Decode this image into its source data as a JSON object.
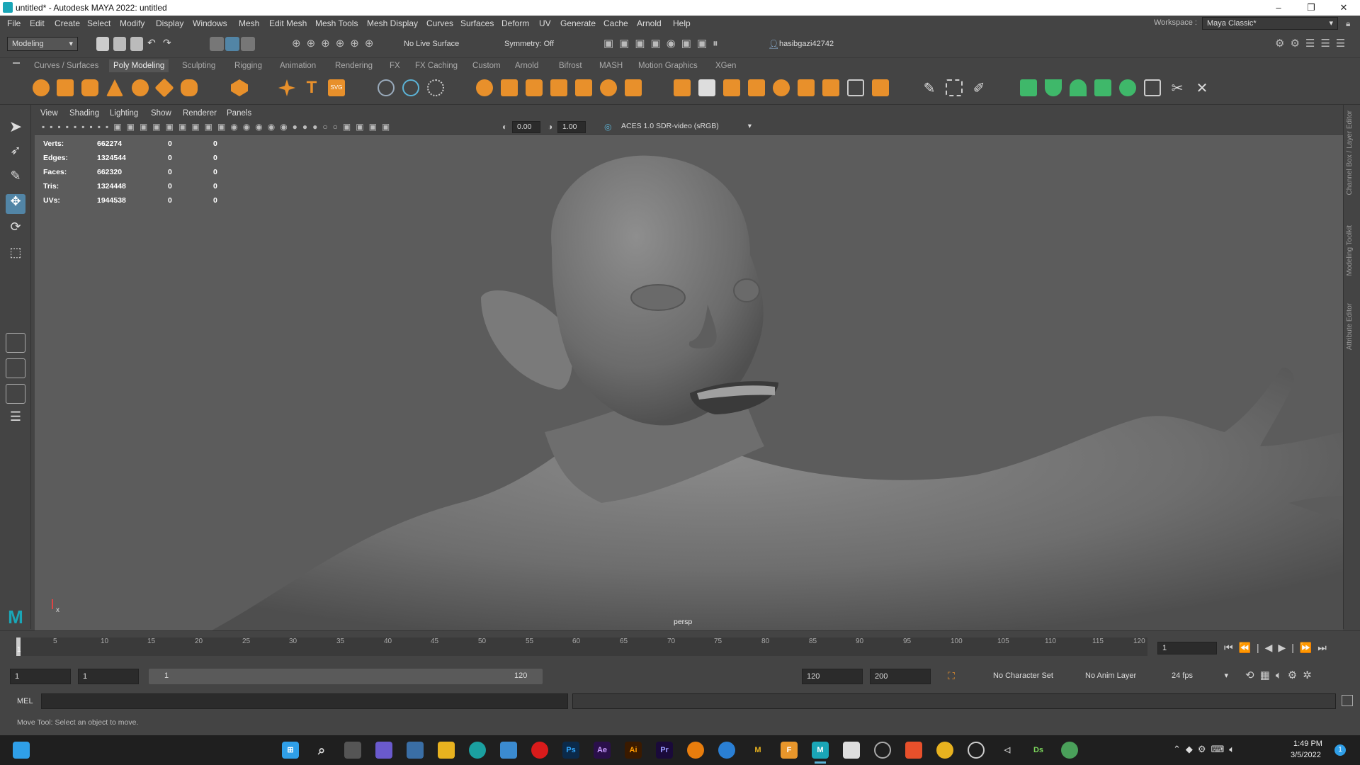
{
  "window": {
    "title": "untitled* - Autodesk MAYA 2022: untitled",
    "minimize": "–",
    "restore": "❐",
    "close": "✕"
  },
  "menu": [
    "File",
    "Edit",
    "Create",
    "Select",
    "Modify",
    "Display",
    "Windows",
    "Mesh",
    "Edit Mesh",
    "Mesh Tools",
    "Mesh Display",
    "Curves",
    "Surfaces",
    "Deform",
    "UV",
    "Generate",
    "Cache",
    "Arnold",
    "Help"
  ],
  "workspace": {
    "label": "Workspace :",
    "value": "Maya Classic*"
  },
  "status": {
    "mode": "Modeling",
    "live_surface": "No Live Surface",
    "symmetry": "Symmetry: Off",
    "user": "hasibgazi42742"
  },
  "shelf_tabs": [
    "Curves / Surfaces",
    "Poly Modeling",
    "Sculpting",
    "Rigging",
    "Animation",
    "Rendering",
    "FX",
    "FX Caching",
    "Custom",
    "Arnold",
    "Bifrost",
    "MASH",
    "Motion Graphics",
    "XGen"
  ],
  "shelf_active": "Poly Modeling",
  "panel_menu": [
    "View",
    "Shading",
    "Lighting",
    "Show",
    "Renderer",
    "Panels"
  ],
  "panel_tool": {
    "exposure": "0.00",
    "gamma": "1.00",
    "color_space": "ACES 1.0 SDR-video (sRGB)"
  },
  "hud": [
    {
      "label": "Verts:",
      "v1": "662274",
      "v2": "0",
      "v3": "0"
    },
    {
      "label": "Edges:",
      "v1": "1324544",
      "v2": "0",
      "v3": "0"
    },
    {
      "label": "Faces:",
      "v1": "662320",
      "v2": "0",
      "v3": "0"
    },
    {
      "label": "Tris:",
      "v1": "1324448",
      "v2": "0",
      "v3": "0"
    },
    {
      "label": "UVs:",
      "v1": "1944538",
      "v2": "0",
      "v3": "0"
    }
  ],
  "camera": "persp",
  "axis": {
    "x": "x"
  },
  "right_tabs": [
    "Channel Box / Layer Editor",
    "Modeling Toolkit",
    "Attribute Editor"
  ],
  "timeline": {
    "ticks": [
      "1",
      "5",
      "10",
      "15",
      "20",
      "25",
      "30",
      "35",
      "40",
      "45",
      "50",
      "55",
      "60",
      "65",
      "70",
      "75",
      "80",
      "85",
      "90",
      "95",
      "100",
      "105",
      "110",
      "115",
      "120"
    ],
    "current": "1"
  },
  "range": {
    "start": "1",
    "start2": "1",
    "slider_start": "1",
    "slider_end": "120",
    "end": "120",
    "end2": "200",
    "character_set": "No Character Set",
    "anim_layer": "No Anim Layer",
    "fps": "24 fps"
  },
  "cmd": {
    "label": "MEL"
  },
  "help": "Move Tool: Select an object to move.",
  "taskbar": {
    "time": "1:49 PM",
    "date": "3/5/2022",
    "notif": "1",
    "apps": [
      {
        "name": "ps",
        "t": "Ps",
        "c": "#0b2a4a"
      },
      {
        "name": "ae",
        "t": "Ae",
        "c": "#2a0f4a"
      },
      {
        "name": "ai",
        "t": "Ai",
        "c": "#3a1a00"
      },
      {
        "name": "pr",
        "t": "Pr",
        "c": "#1a0a3a"
      },
      {
        "name": "m",
        "t": "M",
        "c": "#1f1f1f"
      },
      {
        "name": "f",
        "t": "F",
        "c": "#e8962b"
      },
      {
        "name": "ds",
        "t": "Ds",
        "c": "#1f1f1f"
      }
    ]
  }
}
